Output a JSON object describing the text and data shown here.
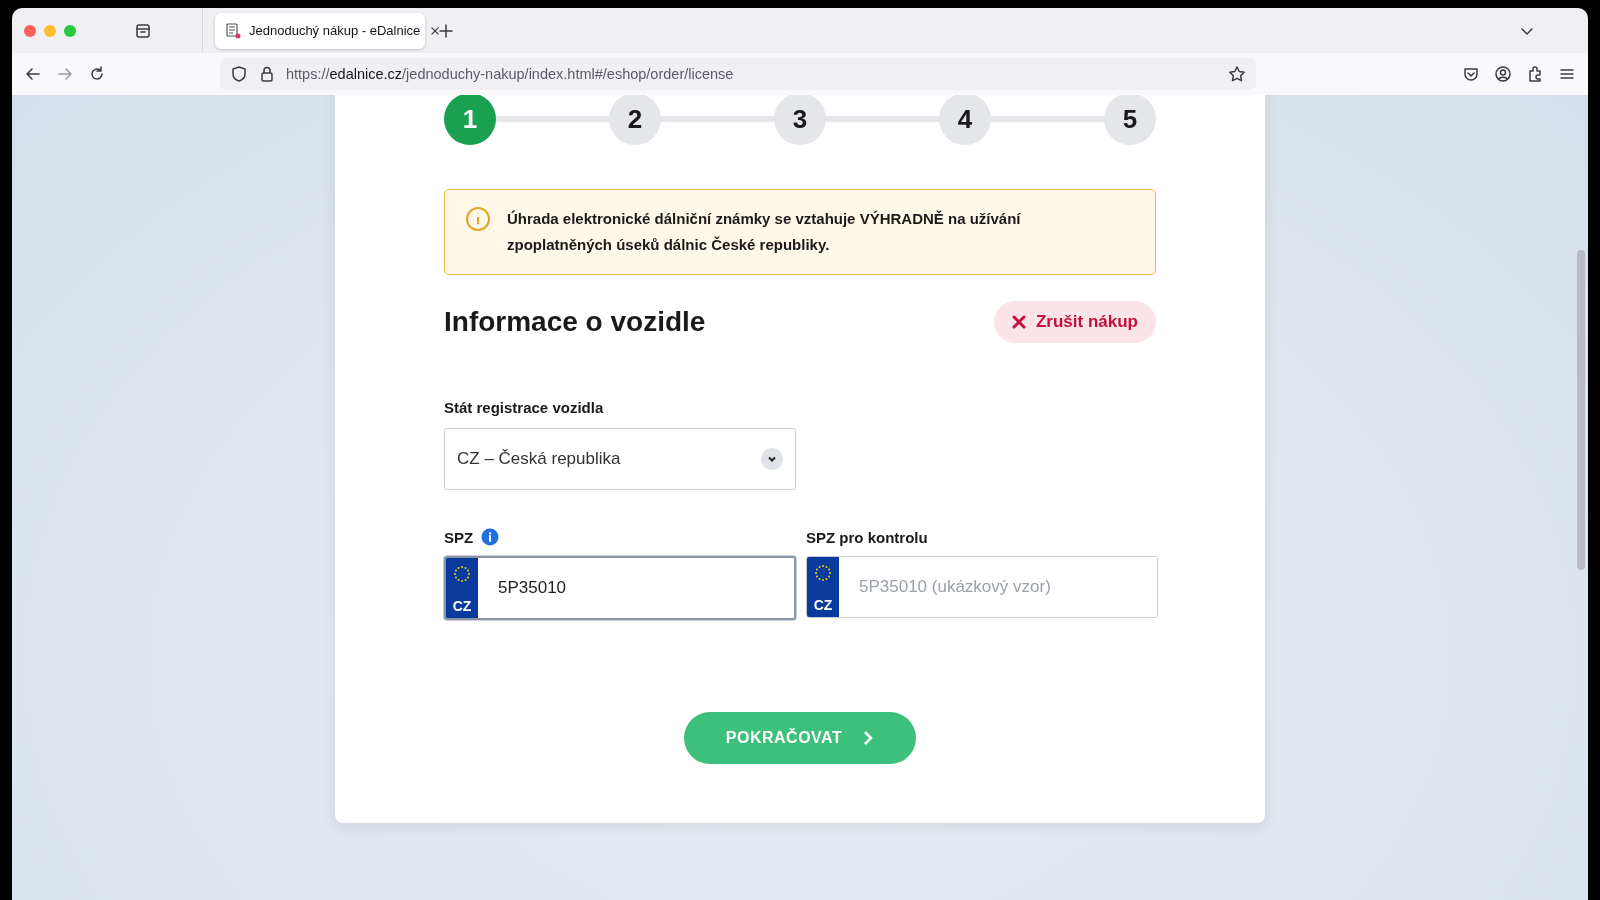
{
  "browser": {
    "tabs": [
      {
        "title": "Jednoduchý nákup - eDalnice",
        "selected": true
      }
    ],
    "address": {
      "scheme": "https://",
      "host": "edalnice.cz",
      "path": "/jednoduchy-nakup/index.html#/eshop/order/license"
    }
  },
  "steps": [
    {
      "label": "1",
      "selected": true
    },
    {
      "label": "2",
      "selected": false
    },
    {
      "label": "3",
      "selected": false
    },
    {
      "label": "4",
      "selected": false
    },
    {
      "label": "5",
      "selected": false
    }
  ],
  "notice": "Úhrada elektronické dálniční známky se vztahuje VÝHRADNĚ na užívání zpoplatněných úseků dálnic České republiky.",
  "heading": "Informace o vozidle",
  "cancel_button": "Zrušit nákup",
  "country_field": {
    "label": "Stát registrace vozidla",
    "value": "CZ – Česká republika"
  },
  "plate_field": {
    "label": "SPZ",
    "country": "CZ",
    "value": "5P35010",
    "focused": true
  },
  "plate_check_field": {
    "label": "SPZ pro kontrolu",
    "country": "CZ",
    "placeholder": "5P35010 (ukázkový vzor)",
    "focused": false
  },
  "continue_button": "POKRAČOVAT"
}
